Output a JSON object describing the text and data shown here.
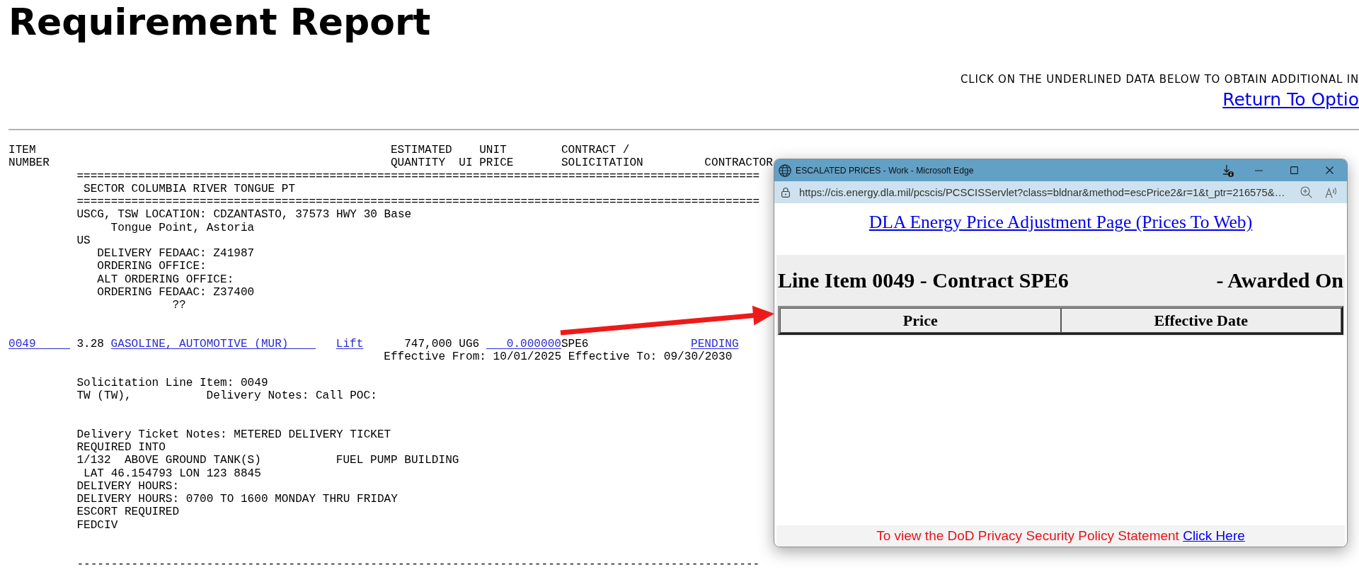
{
  "page": {
    "title": "Requirement Report",
    "instruction": "CLICK ON THE UNDERLINED DATA BELOW TO OBTAIN ADDITIONAL IN",
    "return_link": "Return To Optio"
  },
  "report": {
    "columns": [
      {
        "lines": [
          "ITEM",
          "NUMBER"
        ]
      },
      {
        "lines": [
          "ESTIMATED",
          "QUANTITY"
        ]
      },
      {
        "lines": [
          "UI"
        ]
      },
      {
        "lines": [
          "UNIT",
          "PRICE"
        ]
      },
      {
        "lines": [
          "CONTRACT /",
          "SOLICITATION"
        ]
      },
      {
        "lines": [
          "CONTRACTOR"
        ]
      }
    ],
    "sector": {
      "rule_above": "====================================================================================================",
      "name": "SECTOR COLUMBIA RIVER TONGUE PT",
      "rule_below": "===================================================================================================="
    },
    "location_lines": [
      "USCG, TSW LOCATION: CDZANTASTO, 37573 HWY 30 Base",
      "Tongue Point, Astoria",
      "US",
      "DELIVERY FEDAAC: Z41987",
      "ORDERING OFFICE:",
      "ALT ORDERING OFFICE:",
      "ORDERING FEDAAC: Z37400",
      "??"
    ],
    "item": {
      "item_number": "0049",
      "column_2": "3.28",
      "product": "GASOLINE, AUTOMOTIVE (MUR)",
      "delivery_link": "Lift",
      "quantity": "747,000",
      "ui": "UG6",
      "unit_price": "0.000000",
      "contract": "SPE6",
      "contractor": "PENDING",
      "effective_dates": "Effective From: 10/01/2025 Effective To: 09/30/2030"
    },
    "notes": [
      {
        "parts": [
          "Solicitation Line Item: 0049"
        ]
      },
      {
        "parts": [
          "TW (TW),",
          "Delivery Notes: Call POC:"
        ]
      },
      {
        "parts": [
          "Delivery Ticket Notes: METERED DELIVERY TICKET"
        ]
      },
      {
        "parts": [
          "REQUIRED INTO"
        ]
      },
      {
        "parts": [
          "1/132  ABOVE GROUND TANK(S)",
          "FUEL PUMP BUILDING"
        ]
      },
      {
        "parts": [
          "LAT 46.154793 LON 123 8845"
        ]
      },
      {
        "parts": [
          "DELIVERY HOURS:"
        ]
      },
      {
        "parts": [
          "DELIVERY HOURS: 0700 TO 1600 MONDAY THRU FRIDAY"
        ]
      },
      {
        "parts": [
          "ESCORT REQUIRED"
        ]
      },
      {
        "parts": [
          "FEDCIV"
        ]
      }
    ],
    "rule_end": "----------------------------------------------------------------------------------------------------"
  },
  "popup": {
    "title": "ESCALATED PRICES - Work - Microsoft Edge",
    "url": "https://cis.energy.dla.mil/pcscis/PCSCISServlet?class=bldnar&method=escPrice2&r=1&t_ptr=216575&…",
    "page_link": "DLA Energy Price Adjustment Page (Prices To Web)",
    "heading": "Line Item 0049 - Contract SPE6",
    "heading_right": "- Awarded On",
    "table": {
      "columns": [
        "Price",
        "Effective Date"
      ]
    },
    "footer": {
      "text": "To view the DoD Privacy Security Policy Statement",
      "link": "Click Here"
    }
  }
}
